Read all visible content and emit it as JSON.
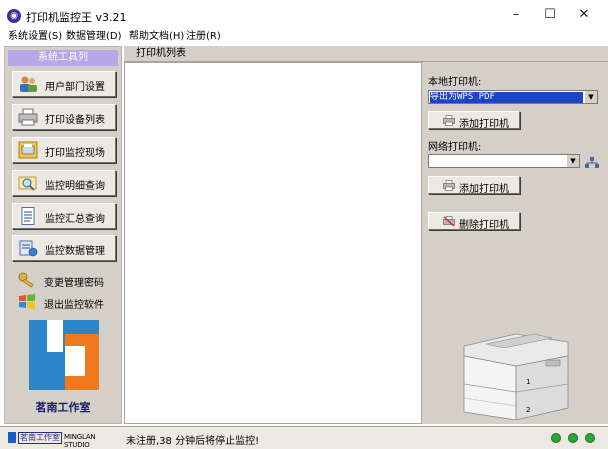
{
  "window": {
    "title": "打印机监控王 v3.21",
    "icon": "app-globe-icon",
    "controls": [
      "–",
      "☐",
      "✕"
    ]
  },
  "menu": [
    "系统设置(S)",
    "数据管理(D)",
    "帮助文档(H)",
    "注册(R)"
  ],
  "sidebar": {
    "header": "系统工具列",
    "buttons": [
      {
        "label": "用户部门设置",
        "icon": "users-icon"
      },
      {
        "label": "打印设备列表",
        "icon": "printer-icon"
      },
      {
        "label": "打印监控现场",
        "icon": "monitor-print-icon"
      },
      {
        "label": "监控明细查询",
        "icon": "search-details-icon"
      },
      {
        "label": "监控汇总查询",
        "icon": "summary-document-icon"
      },
      {
        "label": "监控数据管理",
        "icon": "data-manage-icon"
      }
    ],
    "plain_items": [
      {
        "label": "变更管理密码",
        "icon": "key-icon"
      },
      {
        "label": "退出监控软件",
        "icon": "windows-exit-icon"
      }
    ],
    "logo_text": "茗南工作室"
  },
  "tabs": [
    "打印机列表"
  ],
  "right_panel": {
    "local_label": "本地打印机:",
    "local_value": "导出为WPS PDF",
    "add_local_button": "添加打印机",
    "network_label": "网络打印机:",
    "network_value": "",
    "add_network_button": "添加打印机",
    "delete_button": "删除打印机",
    "tray_labels": [
      "1",
      "2"
    ]
  },
  "status": {
    "studio_cn": "茗南工作室",
    "studio_en": "MINGLAN STUDIO",
    "message": "未注册,38 分钟后将停止监控!",
    "indicator_color": "#2aa633"
  },
  "colors": {
    "sidebar_header": "#b6a7e9",
    "selected": "#1c44c4",
    "logo_blue": "#2b86c9",
    "logo_orange": "#f07b1f"
  }
}
